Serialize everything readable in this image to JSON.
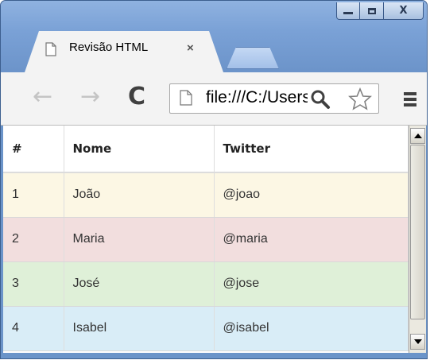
{
  "window": {
    "controls": {
      "minimize": "minimize",
      "maximize": "maximize",
      "close": "X"
    }
  },
  "tab": {
    "title": "Revisão HTML",
    "close_glyph": "×",
    "icon": "page-icon"
  },
  "toolbar": {
    "back_glyph": "←",
    "forward_glyph": "→",
    "reload_glyph": "C",
    "url": "file:///C:/Users",
    "zoom_icon": "zoom-icon",
    "star_icon": "star-icon",
    "menu_icon": "menu-icon"
  },
  "table": {
    "headers": [
      "#",
      "Nome",
      "Twitter"
    ],
    "rows": [
      {
        "num": "1",
        "nome": "João",
        "twitter": "@joao",
        "color": "#fcf7e4"
      },
      {
        "num": "2",
        "nome": "Maria",
        "twitter": "@maria",
        "color": "#f2dede"
      },
      {
        "num": "3",
        "nome": "José",
        "twitter": "@jose",
        "color": "#dff0d8"
      },
      {
        "num": "4",
        "nome": "Isabel",
        "twitter": "@isabel",
        "color": "#d9edf7"
      }
    ]
  },
  "colors": {
    "titlebar": "#7aa1d6",
    "toolbar": "#f3f3f3"
  }
}
